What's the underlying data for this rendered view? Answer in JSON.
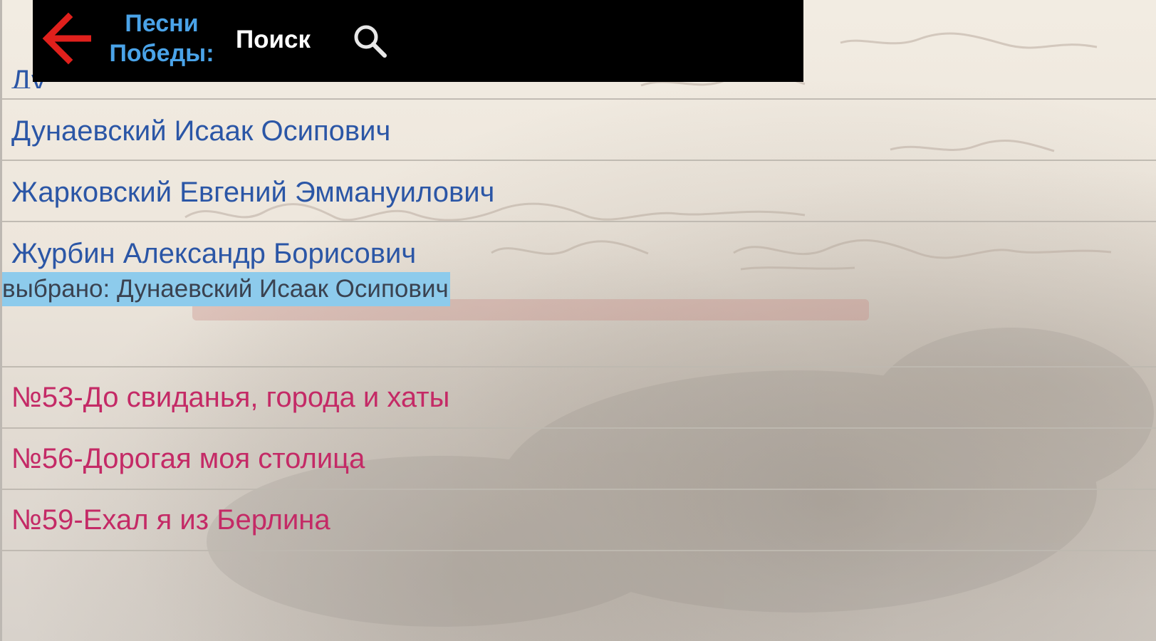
{
  "toolbar": {
    "title_line1": "Песни",
    "title_line2": "Победы:",
    "search_label": "Поиск",
    "back_icon": "arrow-left-icon",
    "search_icon": "search-icon",
    "colors": {
      "background": "#000000",
      "title": "#4aa3e8",
      "back_arrow": "#e0201c",
      "search_label": "#ffffff"
    }
  },
  "composers": {
    "partial_item": "Ду",
    "items": [
      {
        "label": "Дунаевский Исаак Осипович"
      },
      {
        "label": "Жарковский Евгений Эммануилович"
      },
      {
        "label": "Журбин Александр Борисович"
      }
    ],
    "color": "#2b56a6"
  },
  "selection": {
    "text": "выбрано: Дунаевский Исаак Осипович",
    "highlight_color": "#8dcbec"
  },
  "songs": {
    "items": [
      {
        "label": "№53-До свиданья, города и хаты"
      },
      {
        "label": "№56-Дорогая моя столица"
      },
      {
        "label": "№59-Ехал я из Берлина"
      }
    ],
    "color": "#c42a66"
  }
}
